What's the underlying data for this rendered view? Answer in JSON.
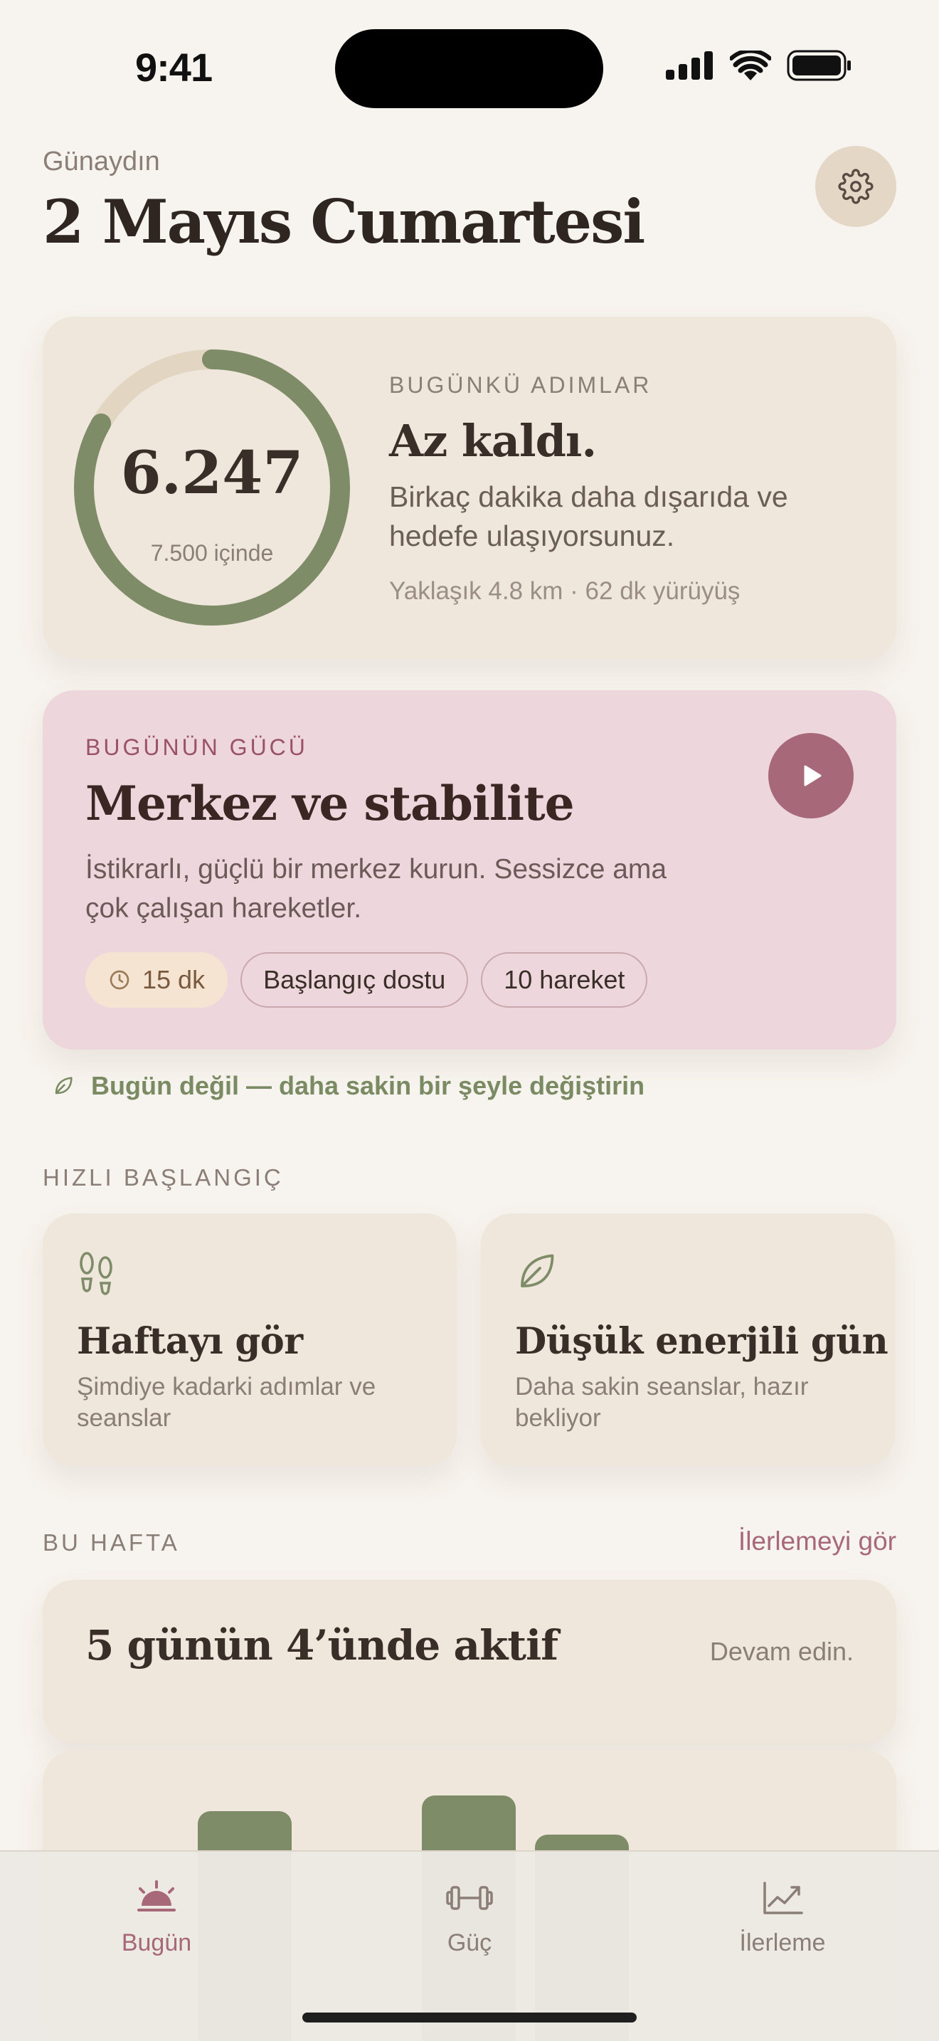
{
  "status": {
    "time": "9:41"
  },
  "header": {
    "greeting": "Günaydın",
    "title": "2 Mayıs Cumartesi",
    "settings_icon": "gear-icon"
  },
  "steps": {
    "count": "6.247",
    "goal_text": "7.500 içinde",
    "progress": 0.833,
    "eyebrow": "BUGÜNKÜ ADIMLAR",
    "headline": "Az kaldı.",
    "body": "Birkaç dakika daha dışarıda ve hedefe ulaşıyorsunuz.",
    "meta": "Yaklaşık 4.8 km · 62 dk yürüyüş"
  },
  "strength": {
    "eyebrow": "BUGÜNÜN GÜCÜ",
    "title": "Merkez ve stabilite",
    "description": "İstikrarlı, güçlü bir merkez kurun. Sessizce ama çok çalışan hareketler.",
    "chips": {
      "duration": "15 dk",
      "level": "Başlangıç dostu",
      "moves": "10 hareket"
    },
    "swap_link": "Bugün değil — daha sakin bir şeyle değiştirin"
  },
  "quick_start": {
    "label": "HIZLI BAŞLANGIÇ",
    "items": [
      {
        "title": "Haftayı gör",
        "subtitle": "Şimdiye kadarki adımlar ve seanslar",
        "icon": "footprints-icon"
      },
      {
        "title": "Düşük enerjili gün",
        "subtitle": "Daha sakin seanslar, hazır bekliyor",
        "icon": "leaf-icon"
      }
    ]
  },
  "this_week": {
    "label": "BU HAFTA",
    "link": "İlerlemeyi gör",
    "title": "5 günün 4’ünde aktif",
    "note": "Devam edin."
  },
  "tabs": [
    {
      "label": "Bugün",
      "icon": "sunrise-icon",
      "active": true
    },
    {
      "label": "Güç",
      "icon": "dumbbell-icon",
      "active": false
    },
    {
      "label": "İlerleme",
      "icon": "trend-chart-icon",
      "active": false
    }
  ],
  "colors": {
    "accent": "#a76879",
    "sage": "#7f8c68",
    "background": "#f7f3ee"
  }
}
